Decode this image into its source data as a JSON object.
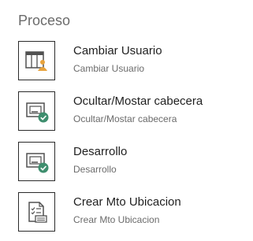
{
  "section": {
    "title": "Proceso"
  },
  "actions": [
    {
      "label": "Cambiar Usuario",
      "description": "Cambiar Usuario",
      "icon": "user-table-icon"
    },
    {
      "label": "Ocultar/Mostar cabecera",
      "description": "Ocultar/Mostar cabecera",
      "icon": "window-check-icon"
    },
    {
      "label": "Desarrollo",
      "description": "Desarrollo",
      "icon": "window-check-icon"
    },
    {
      "label": "Crear Mto Ubicacion",
      "description": "Crear Mto Ubicacion",
      "icon": "checklist-form-icon"
    }
  ],
  "colors": {
    "icon_gray": "#505050",
    "check_green": "#3e8e6e",
    "user_gold": "#e8a33d",
    "tile_border": "#2b2b2b"
  }
}
